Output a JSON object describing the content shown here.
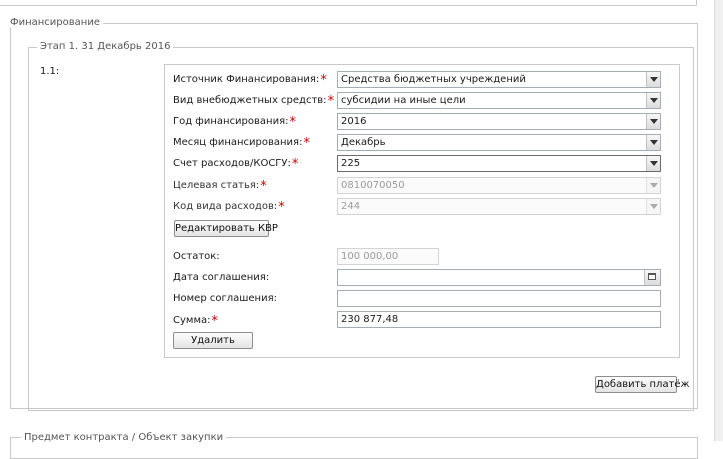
{
  "section": {
    "legend": "Финансирование",
    "stage_legend": "Этап 1. 31 Декабрь 2016",
    "item_number": "1.1:"
  },
  "fields": {
    "source": {
      "label": "Источник Финансирования:",
      "value": "Средства бюджетных учреждений"
    },
    "funds_type": {
      "label": "Вид внебюджетных средств:",
      "value": "субсидии на иные цели"
    },
    "year": {
      "label": "Год финансирования:",
      "value": "2016"
    },
    "month": {
      "label": "Месяц финансирования:",
      "value": "Декабрь"
    },
    "kosgu": {
      "label": "Счет расходов/КОСГУ:",
      "value": "225"
    },
    "target_article": {
      "label": "Целевая статья:",
      "value": "0810070050"
    },
    "expense_type": {
      "label": "Код вида расходов:",
      "value": "244"
    },
    "edit_kvr_label": "Редактировать КВР",
    "remainder": {
      "label": "Остаток:",
      "value": "100 000,00"
    },
    "agreement_date": {
      "label": "Дата соглашения:",
      "value": ""
    },
    "agreement_number": {
      "label": "Номер соглашения:",
      "value": ""
    },
    "amount": {
      "label": "Сумма:",
      "value": "230 877,48"
    },
    "delete_label": "Удалить",
    "required_mark": "*"
  },
  "add_payment_label": "Добавить платёж",
  "next_section_legend": "Предмет контракта / Объект закупки",
  "colors": {
    "required": "#cc0000",
    "border": "#c9c9c9"
  }
}
